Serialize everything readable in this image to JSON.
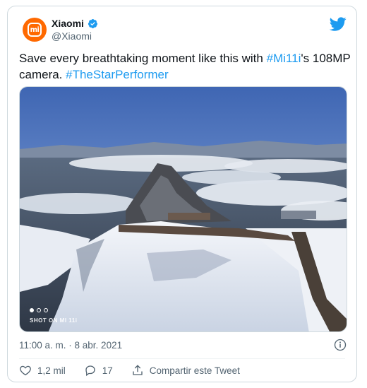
{
  "author": {
    "display_name": "Xiaomi",
    "handle": "@Xiaomi",
    "avatar_text": "mi"
  },
  "tweet": {
    "text_part1": "Save every breathtaking moment like this with ",
    "hashtag1": "#Mi11i",
    "text_part2": "'s 108MP camera. ",
    "hashtag2": "#TheStarPerformer"
  },
  "media": {
    "watermark": "SHOT ON MI 11i",
    "carousel": {
      "count": 3,
      "active_index": 0
    }
  },
  "meta": {
    "timestamp": "11:00 a. m. · 8 abr. 2021"
  },
  "actions": {
    "likes": "1,2 mil",
    "replies": "17",
    "share_label": "Compartir este Tweet"
  },
  "colors": {
    "brand_orange": "#ff6900",
    "twitter_blue": "#1d9bf0",
    "secondary_text": "#536471"
  },
  "icons": {
    "verified": "verified-badge-icon",
    "logo": "twitter-bird-icon",
    "info": "info-icon",
    "like": "heart-icon",
    "reply": "speech-bubble-icon",
    "share": "share-upload-icon"
  }
}
